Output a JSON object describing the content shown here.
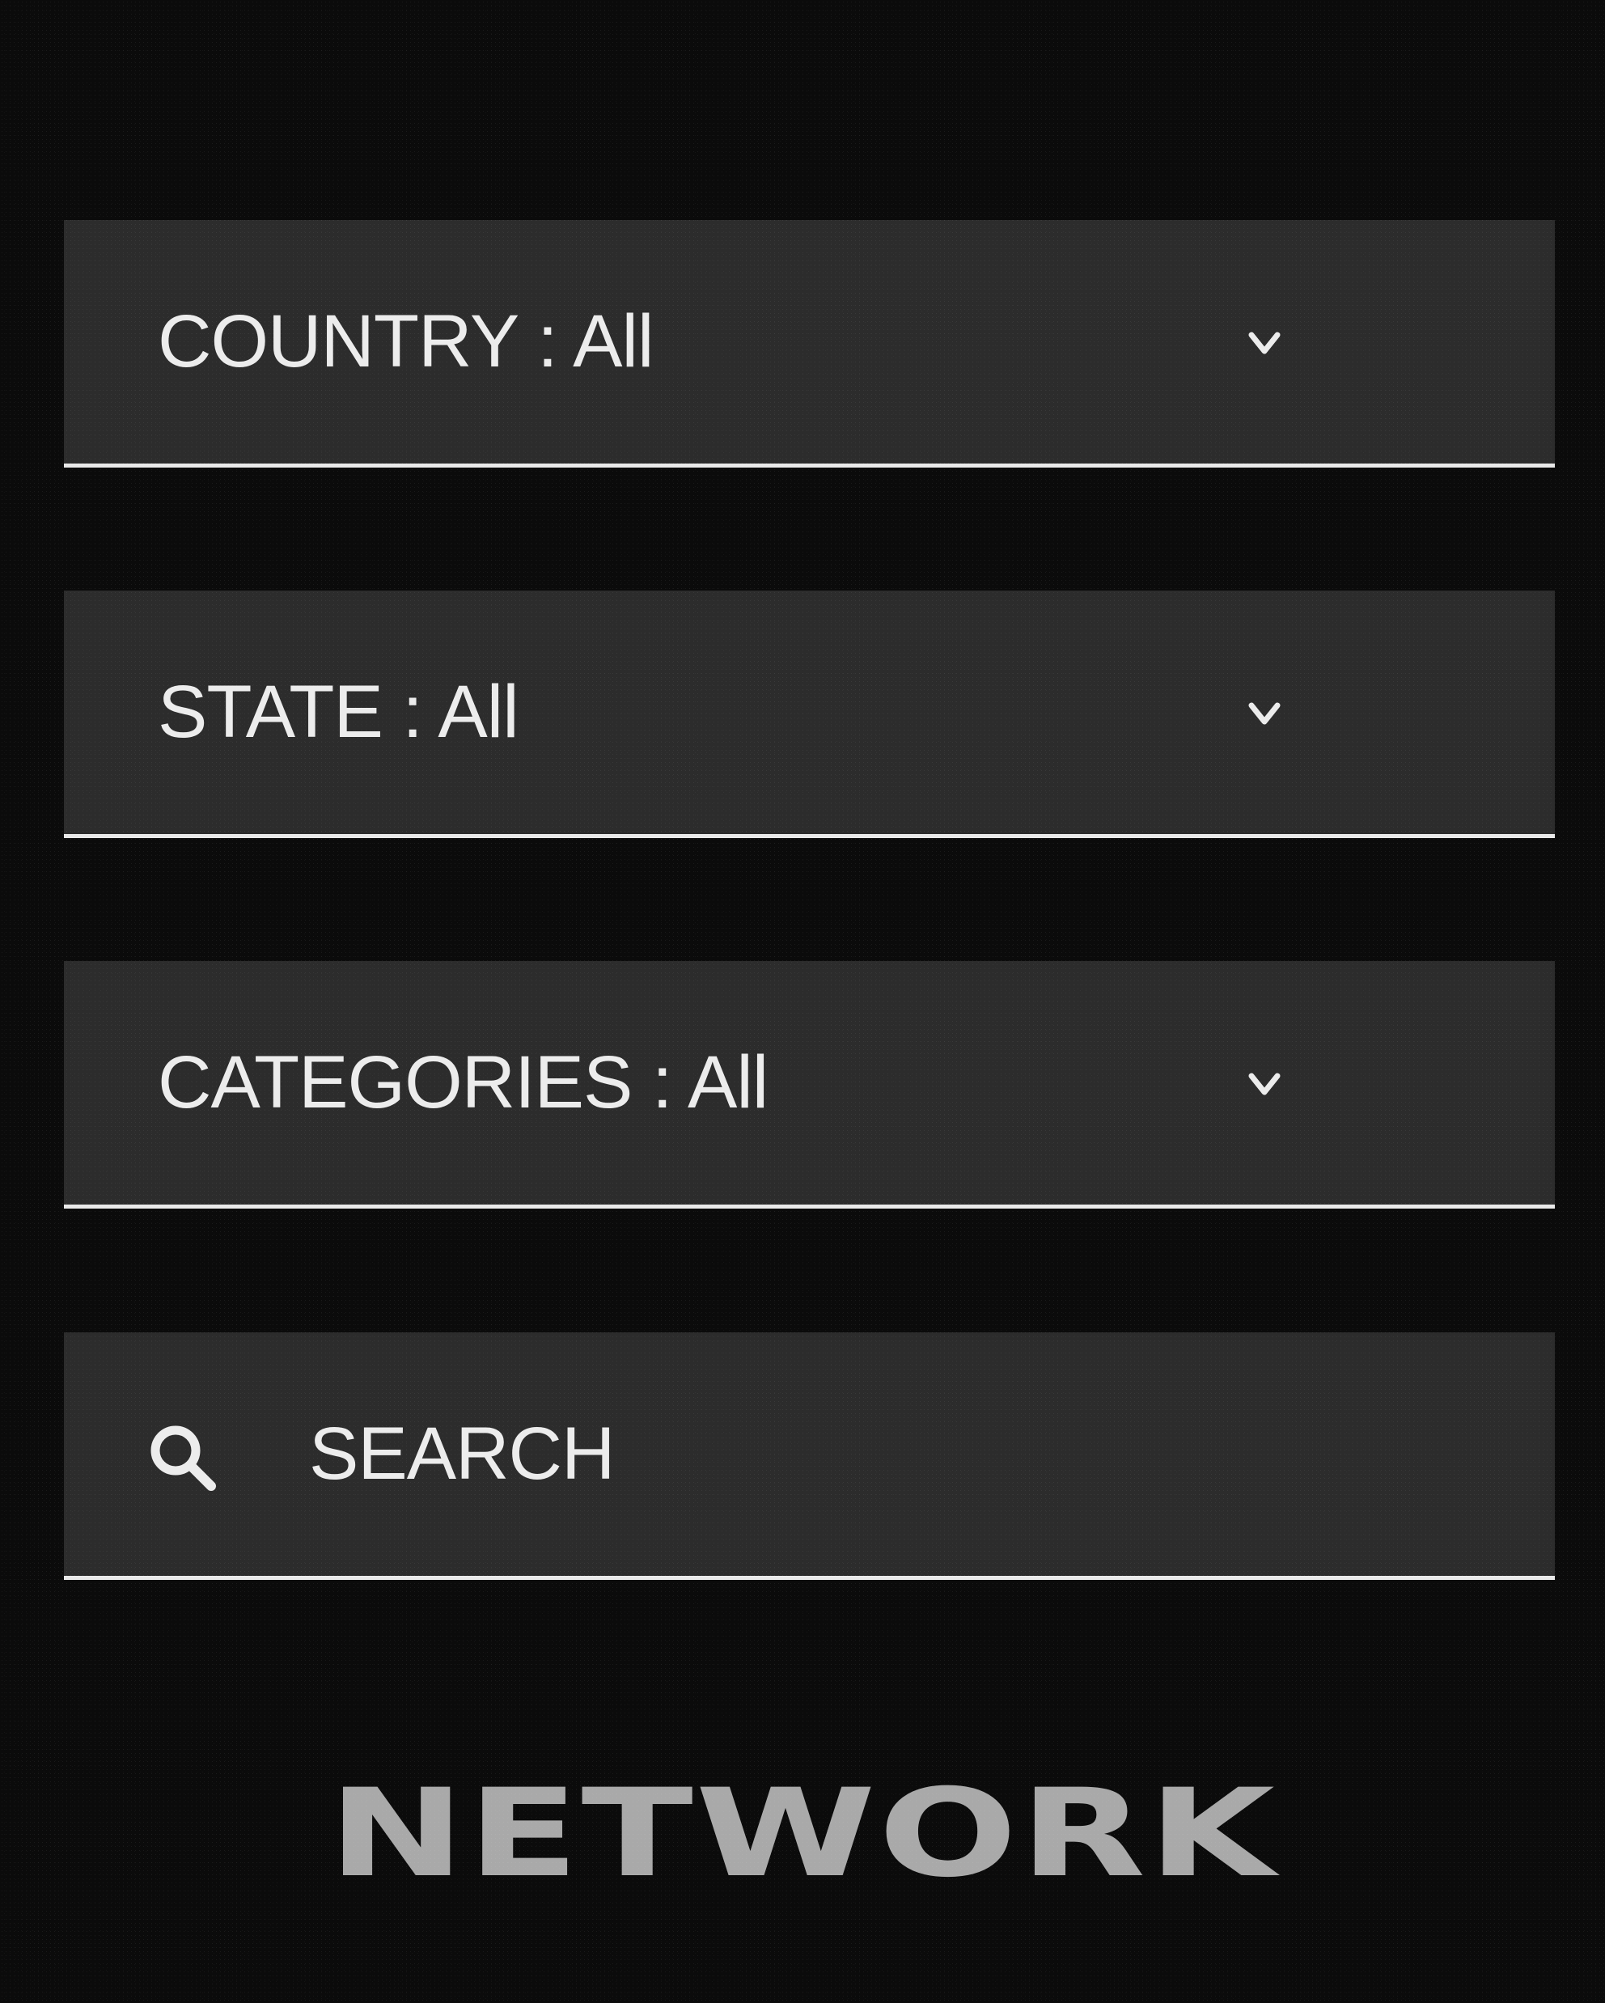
{
  "filters": {
    "country": {
      "label": "COUNTRY : All",
      "icon": "chevron-down-icon"
    },
    "state": {
      "label": "STATE : All",
      "icon": "chevron-down-icon"
    },
    "categories": {
      "label": "CATEGORIES : All",
      "icon": "chevron-down-icon"
    }
  },
  "search": {
    "placeholder": "SEARCH",
    "icon": "search-icon"
  },
  "brand": {
    "name": "NETWORK"
  },
  "colors": {
    "background": "#0b0b0b",
    "field": "#2c2c2c",
    "text": "#ececec",
    "underline": "#e9e9e9",
    "brand": "#a9a9a9"
  }
}
